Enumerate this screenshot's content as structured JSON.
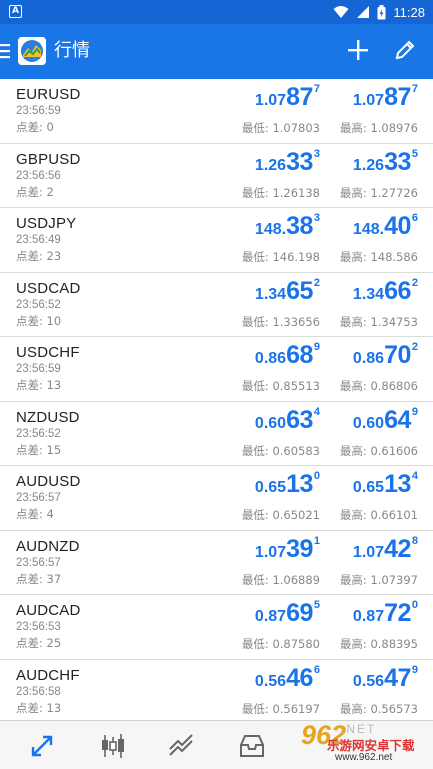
{
  "status_bar": {
    "notification": "A",
    "time": "11:28"
  },
  "app_bar": {
    "title": "行情",
    "menu_icon": "hamburger-menu-icon",
    "logo_icon": "app-logo-icon",
    "actions": [
      "plus-icon",
      "pencil-icon"
    ]
  },
  "quotes": [
    {
      "symbol": "EURUSD",
      "time": "23:56:59",
      "spread_label": "点差:",
      "spread": "0",
      "bid": {
        "prefix": "1.07",
        "big": "87",
        "sup": "7"
      },
      "ask": {
        "prefix": "1.07",
        "big": "87",
        "sup": "7"
      },
      "low_label": "最低:",
      "low": "1.07803",
      "high_label": "最高:",
      "high": "1.08976"
    },
    {
      "symbol": "GBPUSD",
      "time": "23:56:56",
      "spread_label": "点差:",
      "spread": "2",
      "bid": {
        "prefix": "1.26",
        "big": "33",
        "sup": "3"
      },
      "ask": {
        "prefix": "1.26",
        "big": "33",
        "sup": "5"
      },
      "low_label": "最低:",
      "low": "1.26138",
      "high_label": "最高:",
      "high": "1.27726"
    },
    {
      "symbol": "USDJPY",
      "time": "23:56:49",
      "spread_label": "点差:",
      "spread": "23",
      "bid": {
        "prefix": "148.",
        "big": "38",
        "sup": "3"
      },
      "ask": {
        "prefix": "148.",
        "big": "40",
        "sup": "6"
      },
      "low_label": "最低:",
      "low": "146.198",
      "high_label": "最高:",
      "high": "148.586"
    },
    {
      "symbol": "USDCAD",
      "time": "23:56:52",
      "spread_label": "点差:",
      "spread": "10",
      "bid": {
        "prefix": "1.34",
        "big": "65",
        "sup": "2"
      },
      "ask": {
        "prefix": "1.34",
        "big": "66",
        "sup": "2"
      },
      "low_label": "最低:",
      "low": "1.33656",
      "high_label": "最高:",
      "high": "1.34753"
    },
    {
      "symbol": "USDCHF",
      "time": "23:56:59",
      "spread_label": "点差:",
      "spread": "13",
      "bid": {
        "prefix": "0.86",
        "big": "68",
        "sup": "9"
      },
      "ask": {
        "prefix": "0.86",
        "big": "70",
        "sup": "2"
      },
      "low_label": "最低:",
      "low": "0.85513",
      "high_label": "最高:",
      "high": "0.86806"
    },
    {
      "symbol": "NZDUSD",
      "time": "23:56:52",
      "spread_label": "点差:",
      "spread": "15",
      "bid": {
        "prefix": "0.60",
        "big": "63",
        "sup": "4"
      },
      "ask": {
        "prefix": "0.60",
        "big": "64",
        "sup": "9"
      },
      "low_label": "最低:",
      "low": "0.60583",
      "high_label": "最高:",
      "high": "0.61606"
    },
    {
      "symbol": "AUDUSD",
      "time": "23:56:57",
      "spread_label": "点差:",
      "spread": "4",
      "bid": {
        "prefix": "0.65",
        "big": "13",
        "sup": "0"
      },
      "ask": {
        "prefix": "0.65",
        "big": "13",
        "sup": "4"
      },
      "low_label": "最低:",
      "low": "0.65021",
      "high_label": "最高:",
      "high": "0.66101"
    },
    {
      "symbol": "AUDNZD",
      "time": "23:56:57",
      "spread_label": "点差:",
      "spread": "37",
      "bid": {
        "prefix": "1.07",
        "big": "39",
        "sup": "1"
      },
      "ask": {
        "prefix": "1.07",
        "big": "42",
        "sup": "8"
      },
      "low_label": "最低:",
      "low": "1.06889",
      "high_label": "最高:",
      "high": "1.07397"
    },
    {
      "symbol": "AUDCAD",
      "time": "23:56:53",
      "spread_label": "点差:",
      "spread": "25",
      "bid": {
        "prefix": "0.87",
        "big": "69",
        "sup": "5"
      },
      "ask": {
        "prefix": "0.87",
        "big": "72",
        "sup": "0"
      },
      "low_label": "最低:",
      "low": "0.87580",
      "high_label": "最高:",
      "high": "0.88395"
    },
    {
      "symbol": "AUDCHF",
      "time": "23:56:58",
      "spread_label": "点差:",
      "spread": "13",
      "bid": {
        "prefix": "0.56",
        "big": "46",
        "sup": "6"
      },
      "ask": {
        "prefix": "0.56",
        "big": "47",
        "sup": "9"
      },
      "low_label": "最低:",
      "low": "0.56197",
      "high_label": "最高:",
      "high": "0.56573"
    }
  ],
  "bottom_nav": {
    "tabs": [
      "quotes-tab-icon",
      "chart-tab-icon",
      "trade-tab-icon",
      "history-tab-icon"
    ],
    "active_color": "#1a73e8"
  },
  "watermark": {
    "logo_text": "962",
    "net_text": ".NET",
    "cn_text": "乐游网安卓下载",
    "url": "www.962.net"
  },
  "colors": {
    "status_bar": "#1565d4",
    "app_bar": "#1976e6",
    "price": "#1a73e8"
  }
}
